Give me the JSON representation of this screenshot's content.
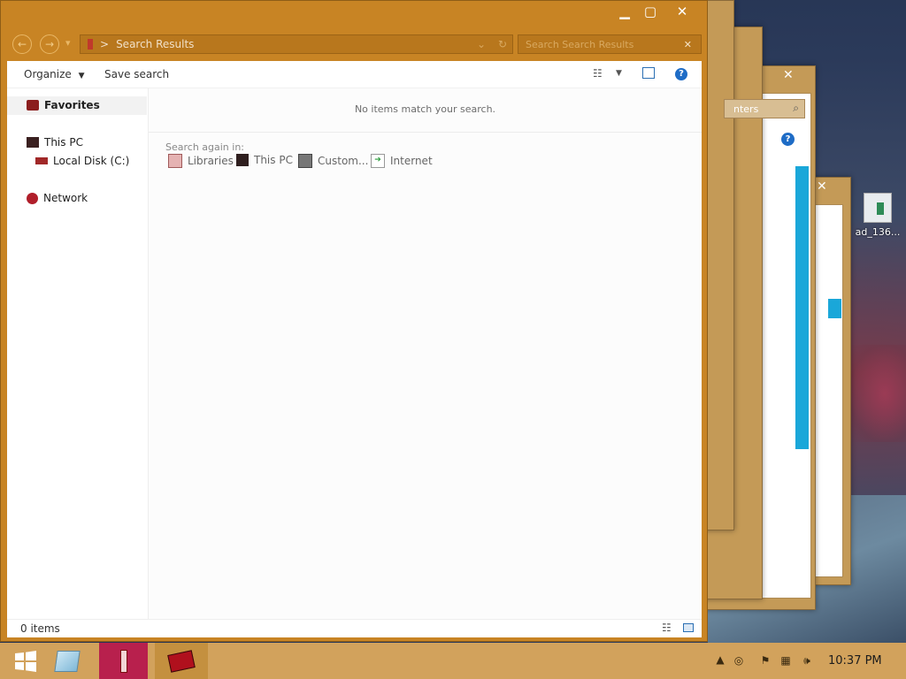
{
  "window": {
    "minimize": "▁",
    "maximize": "▢",
    "close": "✕"
  },
  "nav": {
    "back": "←",
    "forward": "→",
    "recent": "▾",
    "path_sep": ">",
    "path_label": "Search Results",
    "refresh": "↻",
    "search_placeholder": "Search Search Results",
    "search_clear": "✕"
  },
  "toolbar": {
    "organize_label": "Organize",
    "save_search_label": "Save search",
    "help": "?"
  },
  "navpane": {
    "favorites": "Favorites",
    "this_pc": "This PC",
    "local_disk": "Local Disk (C:)",
    "network": "Network"
  },
  "content": {
    "empty_message": "No items match your search.",
    "search_again_label": "Search again in:",
    "locations": [
      "Libraries",
      "This PC",
      "Custom...",
      "Internet"
    ]
  },
  "status": {
    "items_count": "0 items"
  },
  "background_windows": {
    "search_hint": "nters",
    "desktop_icon_label": "ad_136..."
  },
  "taskbar": {
    "clock": "10:37 PM"
  },
  "colors": {
    "window_frame": "#c88424",
    "taskbar": "#d2a25c",
    "accent_cyan": "#1aa7d9"
  }
}
